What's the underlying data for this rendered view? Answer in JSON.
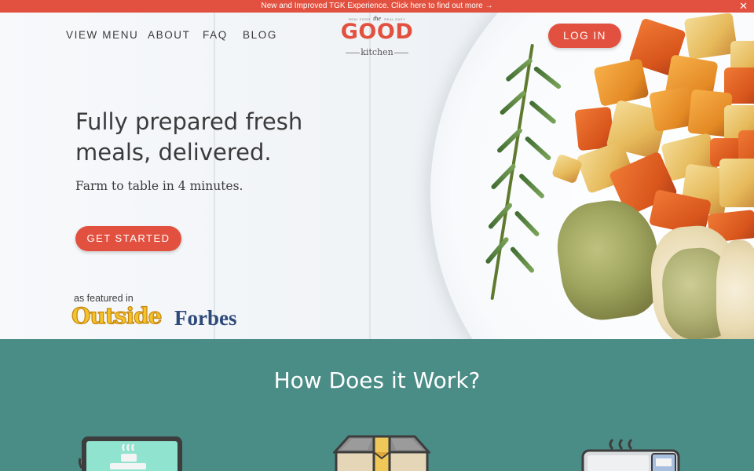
{
  "announcement": {
    "text": "New and Improved TGK Experience. Click here to find out more →",
    "close_glyph": "✕"
  },
  "nav": {
    "items": [
      "VIEW MENU",
      "ABOUT",
      "FAQ",
      "BLOG"
    ],
    "login_label": "LOG IN"
  },
  "logo": {
    "the": "the",
    "tag_left": "REAL FOOD",
    "tag_right": "REAL EASY",
    "word": "GOOD",
    "sub": "kitchen"
  },
  "hero": {
    "headline": "Fully prepared fresh meals, delivered.",
    "subline": "Farm to table in 4 minutes.",
    "cta_label": "GET STARTED",
    "featured_label": "as featured in",
    "press": [
      "Outside",
      "Forbes"
    ]
  },
  "how": {
    "title": "How Does it Work?"
  },
  "icons": {
    "step1": "laptop-menu-icon",
    "step2": "delivery-box-icon",
    "step3": "microwave-icon"
  },
  "colors": {
    "brand_red": "#e2513f",
    "teal": "#4a8c86",
    "text_dark": "#3b3b3b"
  }
}
